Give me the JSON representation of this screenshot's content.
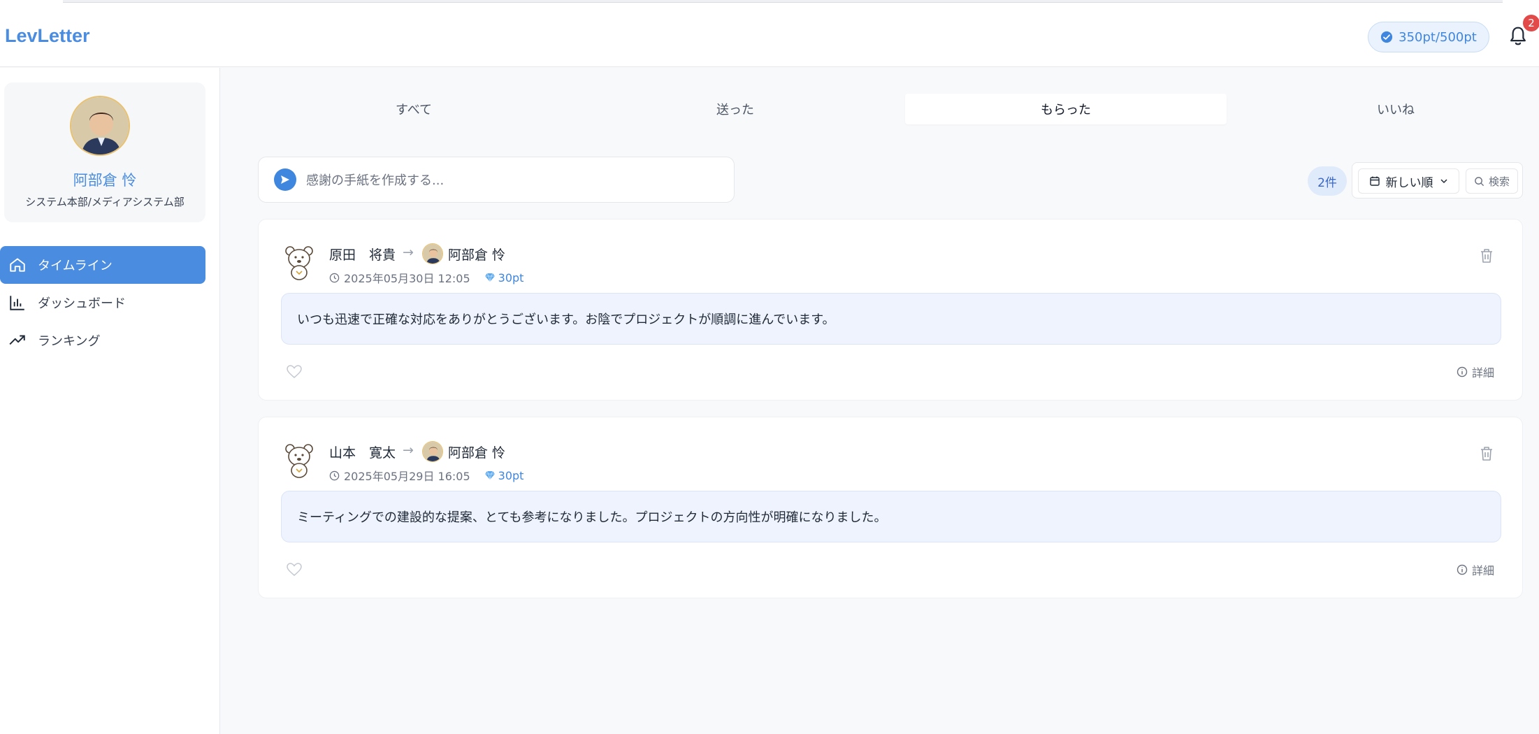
{
  "app": {
    "name": "LevLetter"
  },
  "header": {
    "points": "350pt/500pt",
    "notification_count": "2"
  },
  "profile": {
    "name": "阿部倉 怜",
    "department": "システム本部/メディアシステム部"
  },
  "nav": [
    {
      "label": "タイムライン",
      "icon": "home-icon",
      "active": true
    },
    {
      "label": "ダッシュボード",
      "icon": "bar-chart-icon",
      "active": false
    },
    {
      "label": "ランキング",
      "icon": "trending-up-icon",
      "active": false
    }
  ],
  "tabs": [
    {
      "label": "すべて",
      "active": false
    },
    {
      "label": "送った",
      "active": false
    },
    {
      "label": "もらった",
      "active": true
    },
    {
      "label": "いいね",
      "active": false
    }
  ],
  "compose": {
    "placeholder": "感謝の手紙を作成する..."
  },
  "toolbar": {
    "count": "2件",
    "sort_label": "新しい順",
    "search_label": "検索"
  },
  "letters": [
    {
      "sender": "原田　将貴",
      "receiver": "阿部倉 怜",
      "date": "2025年05月30日 12:05",
      "points": "30pt",
      "message": "いつも迅速で正確な対応をありがとうございます。お陰でプロジェクトが順調に進んでいます。",
      "detail_label": "詳細"
    },
    {
      "sender": "山本　寛太",
      "receiver": "阿部倉 怜",
      "date": "2025年05月29日 16:05",
      "points": "30pt",
      "message": "ミーティングでの建設的な提案、とても参考になりました。プロジェクトの方向性が明確になりました。",
      "detail_label": "詳細"
    }
  ],
  "colors": {
    "accent": "#4a8ce0",
    "badge": "#e24a4a",
    "message_bg": "#eef3fd"
  }
}
